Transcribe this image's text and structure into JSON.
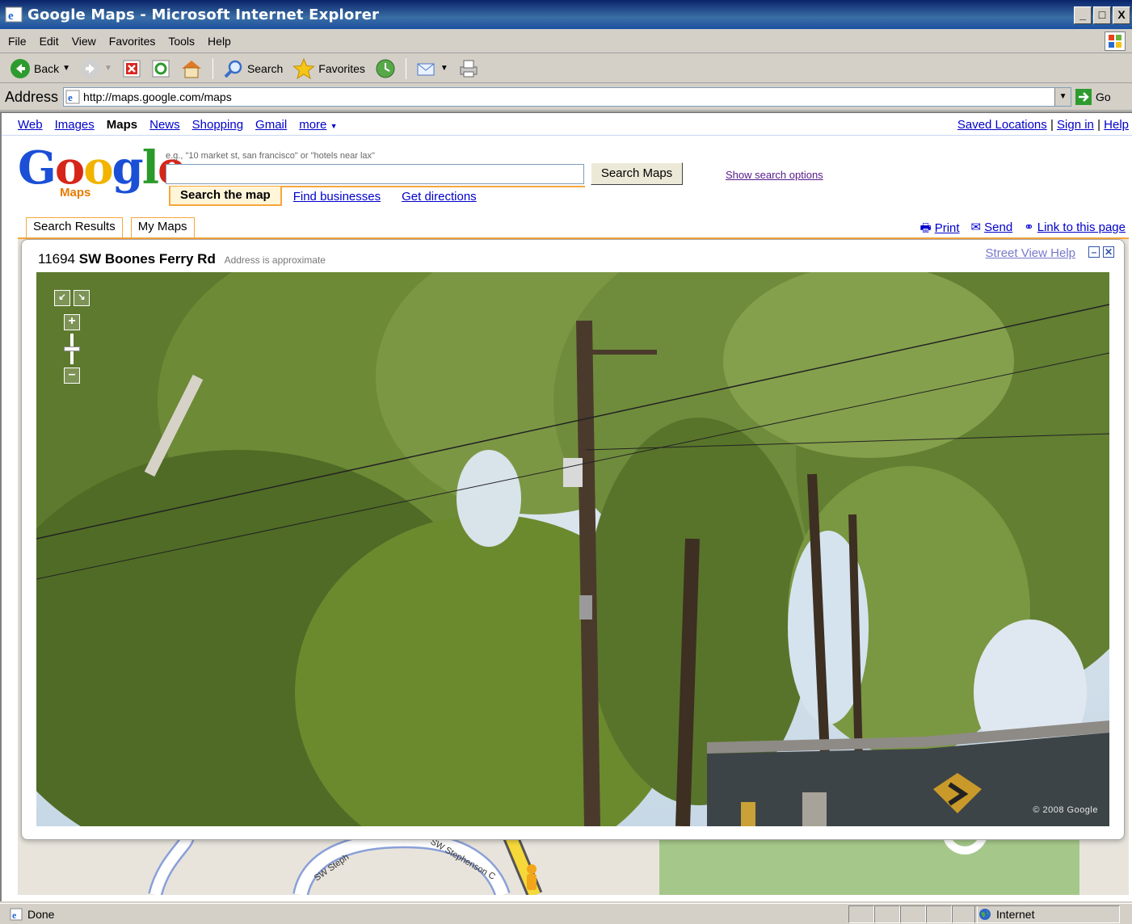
{
  "window": {
    "title": "Google Maps - Microsoft Internet Explorer",
    "min_label": "_",
    "max_label": "□",
    "close_label": "X"
  },
  "menu": [
    "File",
    "Edit",
    "View",
    "Favorites",
    "Tools",
    "Help"
  ],
  "toolbar": {
    "back_label": "Back",
    "search_label": "Search",
    "favorites_label": "Favorites"
  },
  "address": {
    "label": "Address",
    "url": "http://maps.google.com/maps",
    "go_label": "Go"
  },
  "gbar": {
    "links": [
      "Web",
      "Images",
      "Maps",
      "News",
      "Shopping",
      "Gmail",
      "more"
    ],
    "active": "Maps",
    "saved_locations": "Saved Locations",
    "sign_in": "Sign in",
    "help": "Help",
    "separator": "|"
  },
  "logo": {
    "text": "Google",
    "sub": "Maps"
  },
  "search": {
    "hint": "e.g., \"10 market st, san francisco\" or \"hotels near lax\"",
    "value": "",
    "button": "Search Maps",
    "show_options": "Show search options",
    "tabs": [
      "Search the map",
      "Find businesses",
      "Get directions"
    ]
  },
  "results_tabs": [
    "Search Results",
    "My Maps"
  ],
  "share": {
    "print": "Print",
    "send": "Send",
    "link": "Link to this page"
  },
  "street_view": {
    "number": "11694",
    "street": "SW Boones Ferry Rd",
    "note": "Address is approximate",
    "help": "Street View Help",
    "copyright": "© 2008 Google"
  },
  "map_labels": [
    "SW Steph",
    "SW Stephenson C"
  ],
  "status": {
    "text": "Done",
    "zone": "Internet"
  },
  "colors": {
    "title_bar": "#0a246a",
    "accent_orange": "#f7a73c",
    "link_blue": "#0000cc"
  },
  "icons": [
    "ie-icon",
    "back-icon",
    "forward-icon",
    "stop-icon",
    "refresh-icon",
    "home-icon",
    "search-icon",
    "favorites-icon",
    "history-icon",
    "mail-icon",
    "print-icon",
    "go-icon",
    "windows-logo-icon",
    "globe-icon"
  ]
}
